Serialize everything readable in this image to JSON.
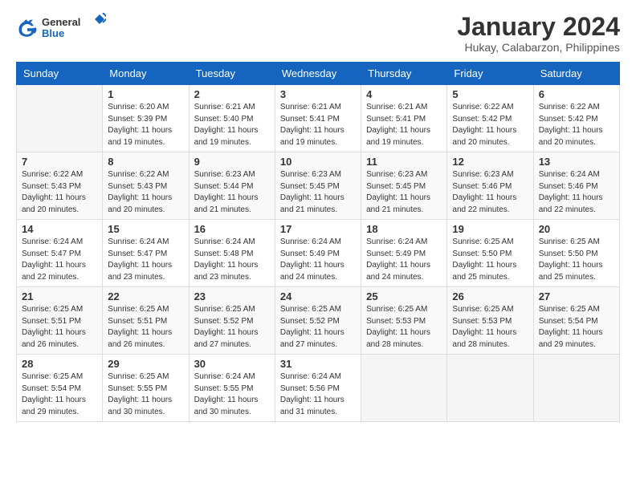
{
  "logo": {
    "general": "General",
    "blue": "Blue"
  },
  "title": "January 2024",
  "location": "Hukay, Calabarzon, Philippines",
  "days_header": [
    "Sunday",
    "Monday",
    "Tuesday",
    "Wednesday",
    "Thursday",
    "Friday",
    "Saturday"
  ],
  "weeks": [
    [
      {
        "day": "",
        "sunrise": "",
        "sunset": "",
        "daylight": ""
      },
      {
        "day": "1",
        "sunrise": "Sunrise: 6:20 AM",
        "sunset": "Sunset: 5:39 PM",
        "daylight": "Daylight: 11 hours and 19 minutes."
      },
      {
        "day": "2",
        "sunrise": "Sunrise: 6:21 AM",
        "sunset": "Sunset: 5:40 PM",
        "daylight": "Daylight: 11 hours and 19 minutes."
      },
      {
        "day": "3",
        "sunrise": "Sunrise: 6:21 AM",
        "sunset": "Sunset: 5:41 PM",
        "daylight": "Daylight: 11 hours and 19 minutes."
      },
      {
        "day": "4",
        "sunrise": "Sunrise: 6:21 AM",
        "sunset": "Sunset: 5:41 PM",
        "daylight": "Daylight: 11 hours and 19 minutes."
      },
      {
        "day": "5",
        "sunrise": "Sunrise: 6:22 AM",
        "sunset": "Sunset: 5:42 PM",
        "daylight": "Daylight: 11 hours and 20 minutes."
      },
      {
        "day": "6",
        "sunrise": "Sunrise: 6:22 AM",
        "sunset": "Sunset: 5:42 PM",
        "daylight": "Daylight: 11 hours and 20 minutes."
      }
    ],
    [
      {
        "day": "7",
        "sunrise": "Sunrise: 6:22 AM",
        "sunset": "Sunset: 5:43 PM",
        "daylight": "Daylight: 11 hours and 20 minutes."
      },
      {
        "day": "8",
        "sunrise": "Sunrise: 6:22 AM",
        "sunset": "Sunset: 5:43 PM",
        "daylight": "Daylight: 11 hours and 20 minutes."
      },
      {
        "day": "9",
        "sunrise": "Sunrise: 6:23 AM",
        "sunset": "Sunset: 5:44 PM",
        "daylight": "Daylight: 11 hours and 21 minutes."
      },
      {
        "day": "10",
        "sunrise": "Sunrise: 6:23 AM",
        "sunset": "Sunset: 5:45 PM",
        "daylight": "Daylight: 11 hours and 21 minutes."
      },
      {
        "day": "11",
        "sunrise": "Sunrise: 6:23 AM",
        "sunset": "Sunset: 5:45 PM",
        "daylight": "Daylight: 11 hours and 21 minutes."
      },
      {
        "day": "12",
        "sunrise": "Sunrise: 6:23 AM",
        "sunset": "Sunset: 5:46 PM",
        "daylight": "Daylight: 11 hours and 22 minutes."
      },
      {
        "day": "13",
        "sunrise": "Sunrise: 6:24 AM",
        "sunset": "Sunset: 5:46 PM",
        "daylight": "Daylight: 11 hours and 22 minutes."
      }
    ],
    [
      {
        "day": "14",
        "sunrise": "Sunrise: 6:24 AM",
        "sunset": "Sunset: 5:47 PM",
        "daylight": "Daylight: 11 hours and 22 minutes."
      },
      {
        "day": "15",
        "sunrise": "Sunrise: 6:24 AM",
        "sunset": "Sunset: 5:47 PM",
        "daylight": "Daylight: 11 hours and 23 minutes."
      },
      {
        "day": "16",
        "sunrise": "Sunrise: 6:24 AM",
        "sunset": "Sunset: 5:48 PM",
        "daylight": "Daylight: 11 hours and 23 minutes."
      },
      {
        "day": "17",
        "sunrise": "Sunrise: 6:24 AM",
        "sunset": "Sunset: 5:49 PM",
        "daylight": "Daylight: 11 hours and 24 minutes."
      },
      {
        "day": "18",
        "sunrise": "Sunrise: 6:24 AM",
        "sunset": "Sunset: 5:49 PM",
        "daylight": "Daylight: 11 hours and 24 minutes."
      },
      {
        "day": "19",
        "sunrise": "Sunrise: 6:25 AM",
        "sunset": "Sunset: 5:50 PM",
        "daylight": "Daylight: 11 hours and 25 minutes."
      },
      {
        "day": "20",
        "sunrise": "Sunrise: 6:25 AM",
        "sunset": "Sunset: 5:50 PM",
        "daylight": "Daylight: 11 hours and 25 minutes."
      }
    ],
    [
      {
        "day": "21",
        "sunrise": "Sunrise: 6:25 AM",
        "sunset": "Sunset: 5:51 PM",
        "daylight": "Daylight: 11 hours and 26 minutes."
      },
      {
        "day": "22",
        "sunrise": "Sunrise: 6:25 AM",
        "sunset": "Sunset: 5:51 PM",
        "daylight": "Daylight: 11 hours and 26 minutes."
      },
      {
        "day": "23",
        "sunrise": "Sunrise: 6:25 AM",
        "sunset": "Sunset: 5:52 PM",
        "daylight": "Daylight: 11 hours and 27 minutes."
      },
      {
        "day": "24",
        "sunrise": "Sunrise: 6:25 AM",
        "sunset": "Sunset: 5:52 PM",
        "daylight": "Daylight: 11 hours and 27 minutes."
      },
      {
        "day": "25",
        "sunrise": "Sunrise: 6:25 AM",
        "sunset": "Sunset: 5:53 PM",
        "daylight": "Daylight: 11 hours and 28 minutes."
      },
      {
        "day": "26",
        "sunrise": "Sunrise: 6:25 AM",
        "sunset": "Sunset: 5:53 PM",
        "daylight": "Daylight: 11 hours and 28 minutes."
      },
      {
        "day": "27",
        "sunrise": "Sunrise: 6:25 AM",
        "sunset": "Sunset: 5:54 PM",
        "daylight": "Daylight: 11 hours and 29 minutes."
      }
    ],
    [
      {
        "day": "28",
        "sunrise": "Sunrise: 6:25 AM",
        "sunset": "Sunset: 5:54 PM",
        "daylight": "Daylight: 11 hours and 29 minutes."
      },
      {
        "day": "29",
        "sunrise": "Sunrise: 6:25 AM",
        "sunset": "Sunset: 5:55 PM",
        "daylight": "Daylight: 11 hours and 30 minutes."
      },
      {
        "day": "30",
        "sunrise": "Sunrise: 6:24 AM",
        "sunset": "Sunset: 5:55 PM",
        "daylight": "Daylight: 11 hours and 30 minutes."
      },
      {
        "day": "31",
        "sunrise": "Sunrise: 6:24 AM",
        "sunset": "Sunset: 5:56 PM",
        "daylight": "Daylight: 11 hours and 31 minutes."
      },
      {
        "day": "",
        "sunrise": "",
        "sunset": "",
        "daylight": ""
      },
      {
        "day": "",
        "sunrise": "",
        "sunset": "",
        "daylight": ""
      },
      {
        "day": "",
        "sunrise": "",
        "sunset": "",
        "daylight": ""
      }
    ]
  ]
}
